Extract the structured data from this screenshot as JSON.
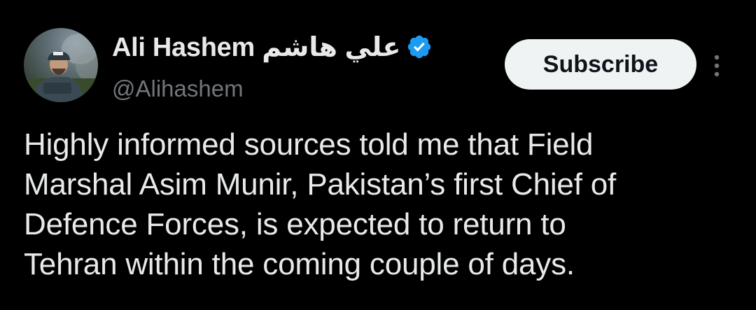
{
  "author": {
    "display_name": "Ali Hashem علي هاشم",
    "handle": "@Alihashem",
    "verified_icon": "verified-badge-icon",
    "verified_color": "#1d9bf0"
  },
  "actions": {
    "subscribe_label": "Subscribe",
    "more_icon": "more-options-icon"
  },
  "post": {
    "lines": [
      "Highly informed sources told me that Field",
      "Marshal Asim Munir, Pakistan’s first Chief of",
      "Defence Forces, is expected to return to",
      "Tehran within the coming couple of days."
    ]
  },
  "colors": {
    "background": "#000000",
    "text": "#e7e9ea",
    "secondary_text": "#71767b",
    "button_bg": "#eff3f4",
    "button_text": "#0f1419"
  }
}
